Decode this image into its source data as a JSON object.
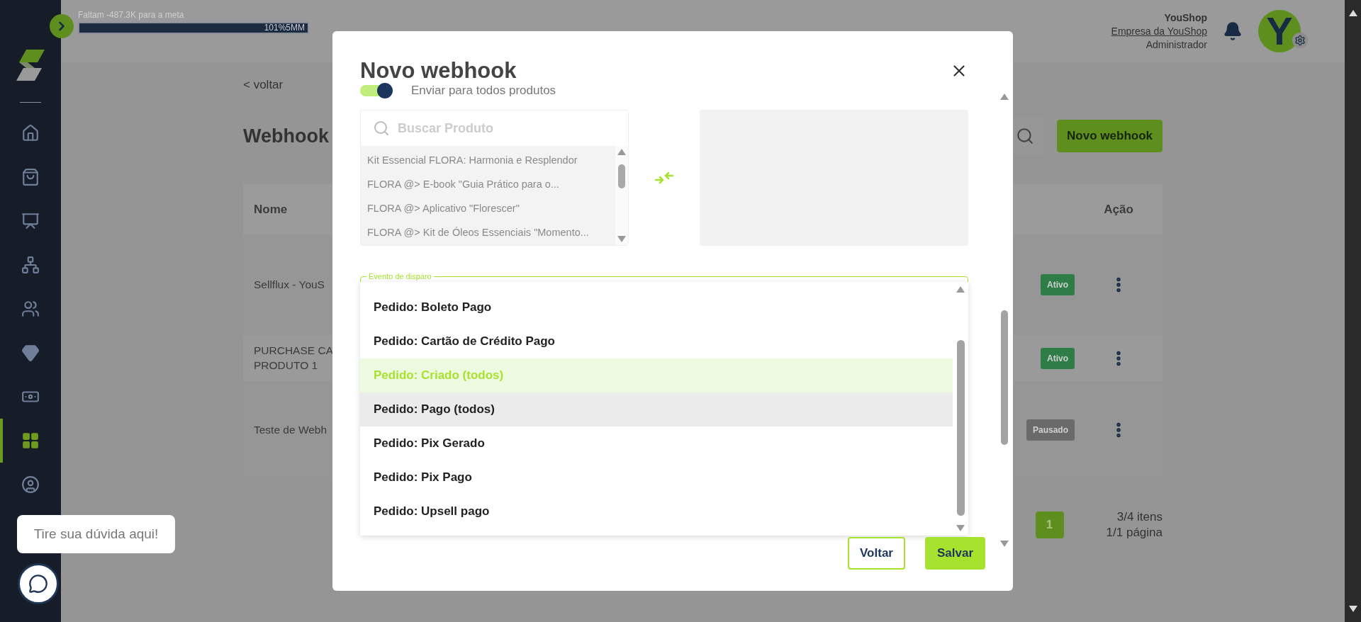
{
  "sidebar": {
    "items": [
      {
        "kind": "home",
        "selected": false
      },
      {
        "kind": "bag",
        "selected": false
      },
      {
        "kind": "board",
        "selected": false
      },
      {
        "kind": "network",
        "selected": false
      },
      {
        "kind": "people",
        "selected": false
      },
      {
        "kind": "gem",
        "selected": false
      },
      {
        "kind": "money",
        "selected": false
      },
      {
        "kind": "apps",
        "selected": true
      },
      {
        "kind": "user",
        "selected": false
      }
    ]
  },
  "goal": {
    "text": "Faltam -487.3K para a meta",
    "level": 1,
    "percent": "101%",
    "target": "5MM"
  },
  "account": {
    "name": "YouShop",
    "company": "Empresa da YouShop",
    "role": "Administrador",
    "avatar": "Y"
  },
  "page": {
    "back": "< voltar",
    "title": "Webhook",
    "new_button": "Novo webhook"
  },
  "table": {
    "columns": [
      "Nome",
      "Ação"
    ],
    "rows": [
      {
        "name": [
          "Sellflux - YouS"
        ],
        "status": {
          "label": "Ativo",
          "kind": "active"
        }
      },
      {
        "name": [
          "PURCHASE CA",
          "PRODUTO 1"
        ],
        "status": {
          "label": "Ativo",
          "kind": "active"
        }
      },
      {
        "name": [
          "Teste de Webh"
        ],
        "status": {
          "label": "Pausado",
          "kind": "paused"
        }
      }
    ]
  },
  "pagination": {
    "pages": [
      {
        "label": "1",
        "selected": true
      }
    ],
    "items": "3/4 itens",
    "page": "1/1 página"
  },
  "modal": {
    "title": "Novo webhook",
    "send_all": {
      "label": "Enviar para todos produtos",
      "on": true
    },
    "product_search": {
      "placeholder": "Buscar Produto"
    },
    "products": [
      "Kit Essencial FLORA: Harmonia e Resplendor",
      "FLORA @> E-book \"Guia Prático para o...",
      "FLORA @> Aplicativo \"Florescer\"",
      "FLORA @> Kit de Óleos Essenciais \"Momento..."
    ],
    "event_field": {
      "label": "Evento de disparo",
      "options": [
        {
          "label": "Pedido: Boleto Pago",
          "selected": false,
          "highlighted": false
        },
        {
          "label": "Pedido: Cartão de Crédito Pago",
          "selected": false,
          "highlighted": false
        },
        {
          "label": "Pedido: Criado (todos)",
          "selected": true,
          "highlighted": false
        },
        {
          "label": "Pedido: Pago (todos)",
          "selected": false,
          "highlighted": true
        },
        {
          "label": "Pedido: Pix Gerado",
          "selected": false,
          "highlighted": false
        },
        {
          "label": "Pedido: Pix Pago",
          "selected": false,
          "highlighted": false
        },
        {
          "label": "Pedido: Upsell pago",
          "selected": false,
          "highlighted": false
        }
      ]
    },
    "buttons": [
      {
        "label": "Voltar",
        "kind": "secondary"
      },
      {
        "label": "Salvar",
        "kind": "primary"
      }
    ]
  },
  "chat": {
    "tooltip": "Tire sua dúvida aqui!"
  }
}
